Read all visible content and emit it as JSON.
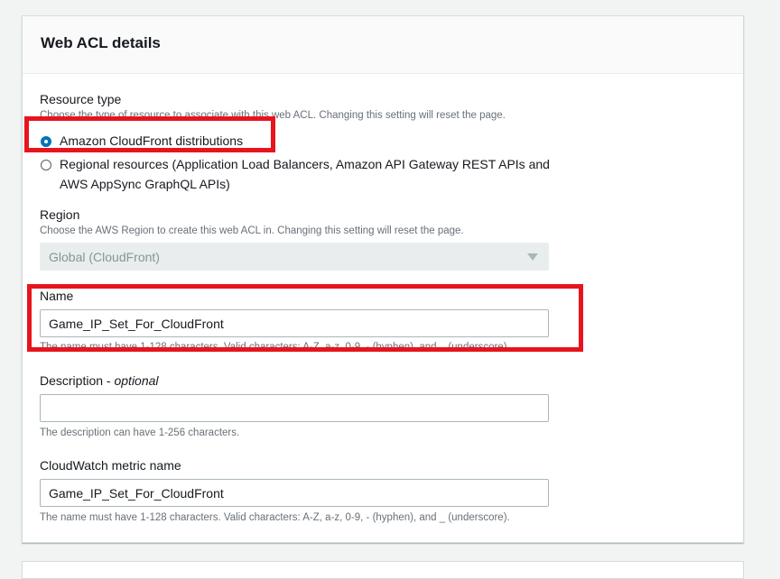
{
  "panel": {
    "title": "Web ACL details"
  },
  "resource_type": {
    "label": "Resource type",
    "hint": "Choose the type of resource to associate with this web ACL. Changing this setting will reset the page.",
    "options": [
      {
        "label": "Amazon CloudFront distributions",
        "selected": true
      },
      {
        "label": "Regional resources (Application Load Balancers, Amazon API Gateway REST APIs and",
        "label_line2": "AWS AppSync GraphQL APIs)",
        "selected": false
      }
    ]
  },
  "region": {
    "label": "Region",
    "hint": "Choose the AWS Region to create this web ACL in. Changing this setting will reset the page.",
    "value": "Global (CloudFront)"
  },
  "name": {
    "label": "Name",
    "value": "Game_IP_Set_For_CloudFront",
    "hint": "The name must have 1-128 characters. Valid characters: A-Z, a-z, 0-9, - (hyphen), and _ (underscore)."
  },
  "description": {
    "label": "Description",
    "optional": "optional",
    "separator": " - ",
    "value": "",
    "hint": "The description can have 1-256 characters."
  },
  "metric": {
    "label": "CloudWatch metric name",
    "value": "Game_IP_Set_For_CloudFront",
    "hint": "The name must have 1-128 characters. Valid characters: A-Z, a-z, 0-9, - (hyphen), and _ (underscore)."
  },
  "annotations": {
    "highlight_color": "#e8141d"
  },
  "colors": {
    "accent": "#0073bb",
    "hint_text": "#687078",
    "disabled_bg": "#eaeded"
  }
}
